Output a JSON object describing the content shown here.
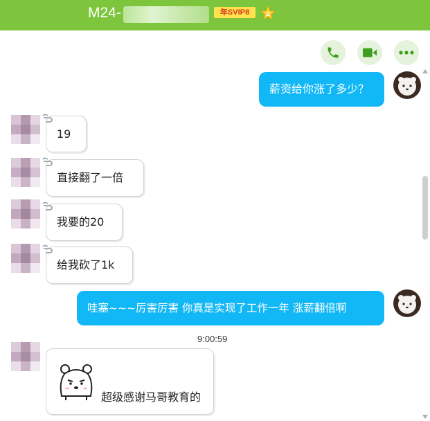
{
  "header": {
    "title": "M24-",
    "vip_badge": "年SVIP8",
    "star_badge": "Z",
    "bg_color": "#7cc53c"
  },
  "toolbar": {
    "buttons": [
      {
        "icon": "phone-icon"
      },
      {
        "icon": "video-icon"
      },
      {
        "icon": "more-icon"
      }
    ]
  },
  "messages": [
    {
      "from": "me",
      "text": "薪资给你涨了多少？"
    },
    {
      "from": "other",
      "text": "19"
    },
    {
      "from": "other",
      "text": "直接翻了一倍"
    },
    {
      "from": "other",
      "text": "我要的20"
    },
    {
      "from": "other",
      "text": "给我砍了1k"
    },
    {
      "from": "me",
      "text": "哇塞~~~厉害厉害  你真是实现了工作一年  涨薪翻倍啊"
    },
    {
      "from": "other",
      "text": "超级感谢马哥教育的"
    }
  ],
  "timestamp": "9:00:59",
  "colors": {
    "outgoing_bubble": "#12b7f5",
    "incoming_bubble": "#ffffff",
    "toolbar_button": "#e5f2dc",
    "accent_green": "#3e9e1e"
  }
}
